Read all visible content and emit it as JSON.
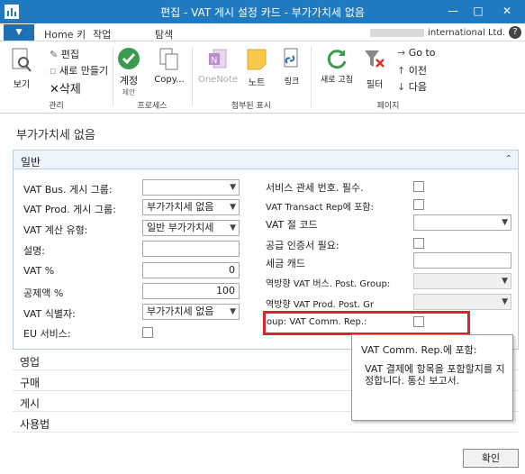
{
  "window": {
    "title": "편집 - VAT 게시 설정 카드        - 부가가치세 없음",
    "minimize": "—",
    "maximize": "□",
    "close": "✕"
  },
  "ribbon_tabs": {
    "app_button": "▼",
    "tabs": [
      "Home 키",
      "작업",
      "탐색"
    ],
    "company": "international Ltd.",
    "help": "?"
  },
  "ribbon": {
    "view_label": "보기",
    "edit_label": "편집",
    "new_label": "새로 만들기",
    "delete_label": "삭제",
    "group_manage": "관리",
    "calc_label": "계정",
    "calc_sub": "제안",
    "copy_label": "Copy...",
    "group_process": "프로세스",
    "onenote_label": "OneNote",
    "note_label": "노트",
    "link_label": "링크",
    "group_attach": "첨부된 표시",
    "refresh_label": "새로 고침",
    "clear_filter_label": "필터 지우기",
    "filter_label": "필터",
    "goto_label": "Go to",
    "prev_label": "이전",
    "next_label": "다음",
    "group_page": "페이지"
  },
  "page": {
    "title": "부가가치세 없음",
    "general_section": "일반",
    "collapse_icon": "⌃"
  },
  "fields_left": [
    {
      "label": "VAT Bus. 게시 그룹:",
      "value": ""
    },
    {
      "label": "VAT Prod. 게시 그룹:",
      "value": "부가가치세 없음"
    },
    {
      "label": "VAT 계산 유형:",
      "value": "일반 부가가치세"
    },
    {
      "label": "설명:",
      "value": ""
    },
    {
      "label": "VAT %",
      "value": "0"
    },
    {
      "label": "공제액 %",
      "value": "100"
    },
    {
      "label": "VAT 식별자:",
      "value": "부가가치세 없음"
    },
    {
      "label": "EU 서비스:",
      "value": ""
    }
  ],
  "fields_right": [
    {
      "label": "서비스 관세 번호. 필수.",
      "value": ""
    },
    {
      "label": "VAT Transact Rep에 포함:",
      "value": ""
    },
    {
      "label": "VAT 절 코드",
      "value": ""
    },
    {
      "label": "공급 인증서 필요:",
      "value": ""
    },
    {
      "label": "세금 캐드",
      "value": ""
    },
    {
      "label": "역방향 VAT 버스. Post. Group:",
      "value": ""
    },
    {
      "label": "역방향 VAT Prod. Post. Gr",
      "value": ""
    },
    {
      "label": "oup: VAT Comm. Rep.:",
      "value": ""
    }
  ],
  "sections_collapsed": [
    "영업",
    "구매",
    "게시",
    "사용법"
  ],
  "tooltip": {
    "title": "VAT Comm. Rep.에 포함:",
    "body": "VAT 결제에 항목을 포함할지를 지정합니다. 통신 보고서."
  },
  "ok_button": "확인",
  "colors": {
    "titlebar": "#1f7ac2",
    "highlight": "#e0202a",
    "section_bg": "#eef4fb"
  }
}
